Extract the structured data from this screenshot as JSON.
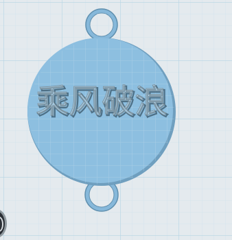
{
  "workplane": {
    "background": "#e4eaee",
    "grid_minor_color": "#cfe2ec",
    "grid_major_color": "#b4d4e3"
  },
  "model": {
    "body_color": "#8dbfe0",
    "body_edge_color": "#6f9fbf",
    "ring_color": "#8dbfe0",
    "engraving_text": "乘风破浪"
  },
  "view_control": {
    "icon": "view-cube-icon"
  }
}
